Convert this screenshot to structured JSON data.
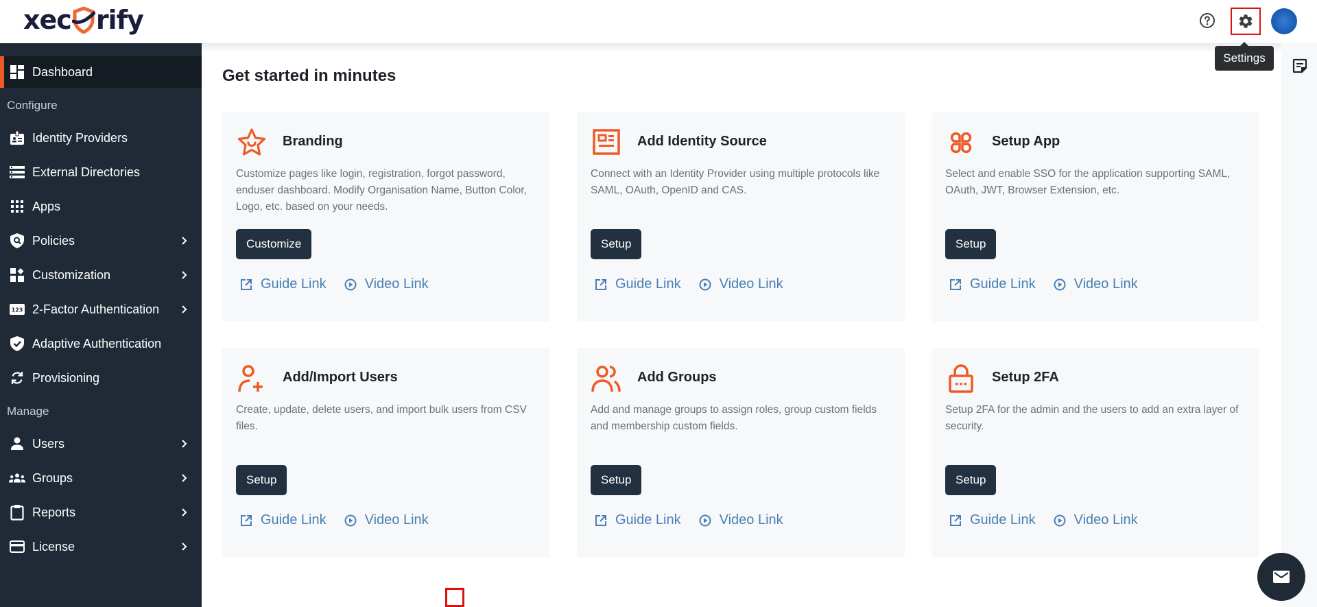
{
  "header": {
    "logo_text_left": "xec",
    "logo_text_right": "rify",
    "help_icon": "help-circle-icon",
    "settings_icon": "gear-icon",
    "tooltip": "Settings"
  },
  "sidebar": {
    "active": {
      "label": "Dashboard",
      "icon": "dashboard-icon"
    },
    "sections": [
      {
        "label": "Configure",
        "items": [
          {
            "label": "Identity Providers",
            "icon": "id-badge-icon",
            "has_submenu": false
          },
          {
            "label": "External Directories",
            "icon": "server-list-icon",
            "has_submenu": false
          },
          {
            "label": "Apps",
            "icon": "apps-grid-icon",
            "has_submenu": false
          },
          {
            "label": "Policies",
            "icon": "shield-search-icon",
            "has_submenu": true
          },
          {
            "label": "Customization",
            "icon": "widgets-icon",
            "has_submenu": true
          },
          {
            "label": "2-Factor Authentication",
            "icon": "pin-123-icon",
            "has_submenu": true
          },
          {
            "label": "Adaptive Authentication",
            "icon": "shield-check-icon",
            "has_submenu": false
          },
          {
            "label": "Provisioning",
            "icon": "sync-icon",
            "has_submenu": false
          }
        ]
      },
      {
        "label": "Manage",
        "items": [
          {
            "label": "Users",
            "icon": "user-icon",
            "has_submenu": true
          },
          {
            "label": "Groups",
            "icon": "groups-icon",
            "has_submenu": true
          },
          {
            "label": "Reports",
            "icon": "clipboard-icon",
            "has_submenu": true
          },
          {
            "label": "License",
            "icon": "credit-card-icon",
            "has_submenu": true
          }
        ]
      }
    ]
  },
  "main": {
    "title": "Get started in minutes",
    "cards": [
      {
        "title": "Branding",
        "icon": "star-smile-icon",
        "description": "Customize pages like login, registration, forgot password, enduser dashboard. Modify Organisation Name, Button Color, Logo, etc. based on your needs.",
        "button": "Customize",
        "guide_link": "Guide Link",
        "video_link": "Video Link"
      },
      {
        "title": "Add Identity Source",
        "icon": "id-card-icon",
        "description": "Connect with an Identity Provider using multiple protocols like SAML, OAuth, OpenID and CAS.",
        "button": "Setup",
        "guide_link": "Guide Link",
        "video_link": "Video Link"
      },
      {
        "title": "Setup App",
        "icon": "app-clover-icon",
        "description": "Select and enable SSO for the application supporting SAML, OAuth, JWT, Browser Extension, etc.",
        "button": "Setup",
        "guide_link": "Guide Link",
        "video_link": "Video Link"
      },
      {
        "title": "Add/Import Users",
        "icon": "user-add-icon",
        "description": "Create, update, delete users, and import bulk users from CSV files.",
        "button": "Setup",
        "guide_link": "Guide Link",
        "video_link": "Video Link"
      },
      {
        "title": "Add Groups",
        "icon": "users-group-icon",
        "description": "Add and manage groups to assign roles, group custom fields and membership custom fields.",
        "button": "Setup",
        "guide_link": "Guide Link",
        "video_link": "Video Link"
      },
      {
        "title": "Setup 2FA",
        "icon": "lock-password-icon",
        "description": "Setup 2FA for the admin and the users to add an extra layer of security.",
        "button": "Setup",
        "guide_link": "Guide Link",
        "video_link": "Video Link"
      }
    ]
  },
  "colors": {
    "accent": "#ee5a24",
    "sidebar_bg": "#1f2a36",
    "button_bg": "#22313f",
    "link": "#4a7fb5",
    "highlight_box": "#e01010"
  }
}
